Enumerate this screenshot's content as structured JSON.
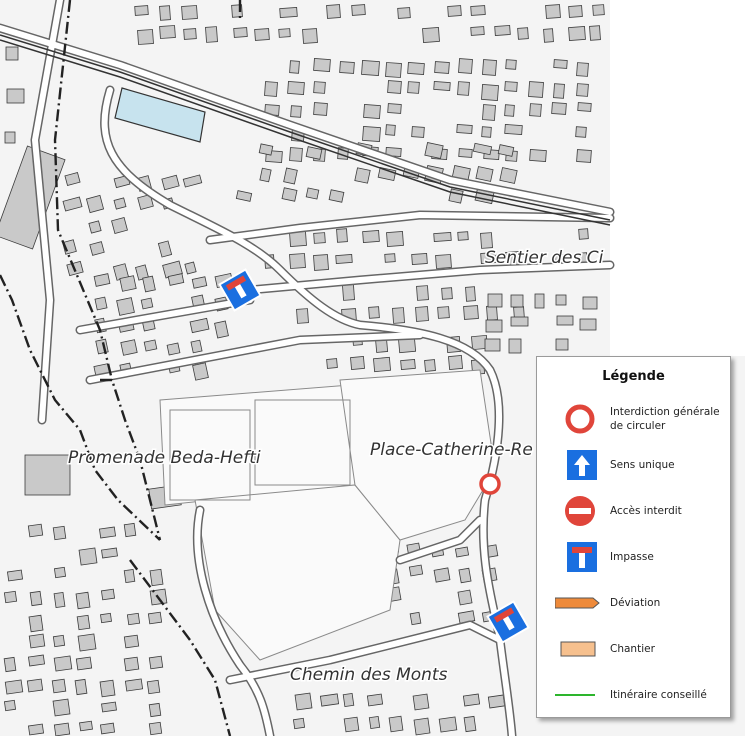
{
  "streets": {
    "beda": "Promenade Beda-Hefti",
    "catherine": "Place-Catherine-Re",
    "sentier": "Sentier des Ci",
    "monts": "Chemin des Monts"
  },
  "legend": {
    "title": "Légende",
    "items": [
      {
        "icon": "closure-circle-icon",
        "label": "Interdiction générale de circuler",
        "color": "#e0453a"
      },
      {
        "icon": "one-way-arrow-icon",
        "label": "Sens unique",
        "color": "#1a6fe0"
      },
      {
        "icon": "no-entry-icon",
        "label": "Accès interdit",
        "color": "#e0453a"
      },
      {
        "icon": "dead-end-icon",
        "label": "Impasse",
        "color": "#1a6fe0"
      },
      {
        "icon": "deviation-arrow-icon",
        "label": "Déviation",
        "color": "#ee8a3a"
      },
      {
        "icon": "construction-area-icon",
        "label": "Chantier",
        "color": "#f6c08e"
      },
      {
        "icon": "recommended-route-line-icon",
        "label": "Itinéraire conseillé",
        "color": "#2db52d"
      }
    ]
  }
}
